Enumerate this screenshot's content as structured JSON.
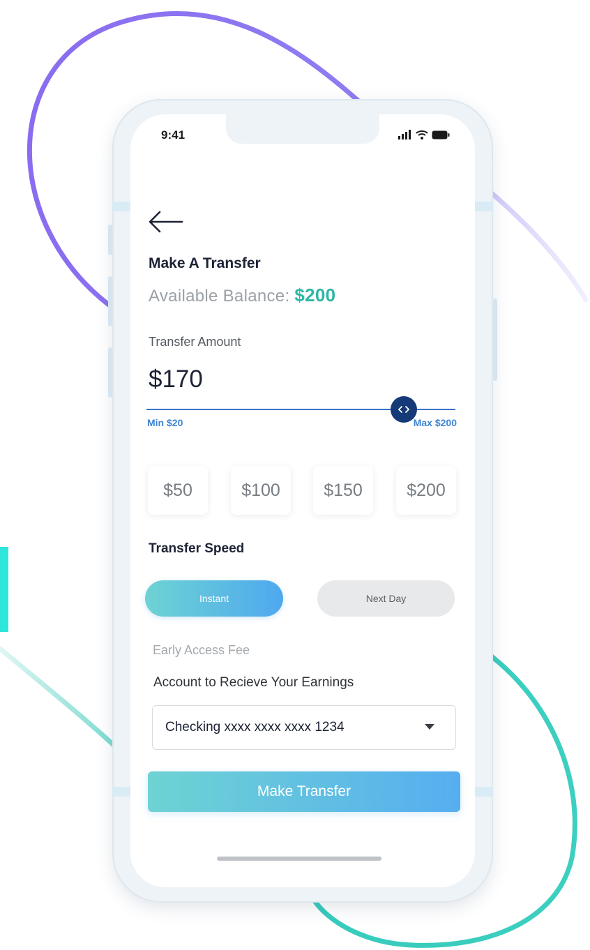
{
  "status_bar": {
    "time": "9:41"
  },
  "screen": {
    "title": "Make A Transfer",
    "balance_label": "Available Balance:",
    "balance_value": "$200"
  },
  "transfer_amount": {
    "label": "Transfer Amount",
    "value": "$170",
    "slider": {
      "min_label": "Min $20",
      "max_label": "Max $200",
      "min": 20,
      "max": 200,
      "value": 170
    }
  },
  "quick_amounts": [
    "$50",
    "$100",
    "$150",
    "$200"
  ],
  "transfer_speed": {
    "title": "Transfer Speed",
    "options": [
      {
        "label": "Instant",
        "selected": true
      },
      {
        "label": "Next Day",
        "selected": false
      }
    ]
  },
  "early_access_fee_label": "Early Access Fee",
  "account": {
    "label": "Account to Recieve Your Earnings",
    "selected": "Checking xxxx xxxx xxxx 1234"
  },
  "cta_label": "Make Transfer",
  "icons": {
    "back": "arrow-left-icon",
    "signal": "signal-icon",
    "wifi": "wifi-icon",
    "battery": "battery-icon",
    "slider_thumb": "chevrons-left-right-icon",
    "dropdown": "caret-down-icon"
  },
  "colors": {
    "accent_teal": "#2fb7a6",
    "slider_blue": "#3a72c9",
    "thumb_navy": "#163a78",
    "gradient_start": "#6ed3d3",
    "gradient_end": "#4fa8ef"
  }
}
